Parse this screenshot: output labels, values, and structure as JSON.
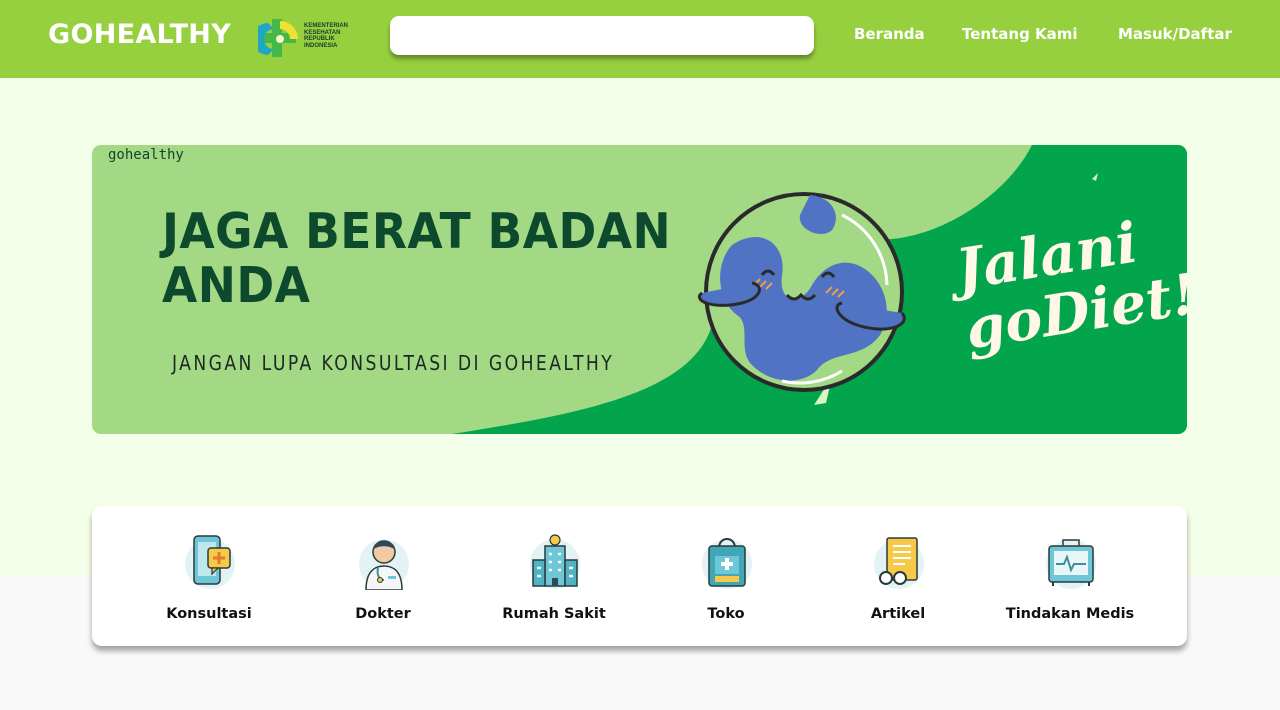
{
  "navbar": {
    "brand": "GOHEALTHY",
    "ministry_logo_text": "KEMENTERIAN KESEHATAN REPUBLIK INDONESIA",
    "search_value": "",
    "links": {
      "home": "Beranda",
      "about": "Tentang Kami",
      "login": "Masuk/Daftar"
    }
  },
  "banner": {
    "logo_text": "gohealthy",
    "headline": "JAGA BERAT BADAN ANDA",
    "subtitle": "JANGAN LUPA KONSULTASI DI GOHEALTHY",
    "script_text": "Jalani goDiet!",
    "colors": {
      "light": "#a3d884",
      "dark": "#02a54b",
      "text": "#0d4a2d"
    }
  },
  "services": [
    {
      "label": "Konsultasi",
      "icon": "phone-chat-icon"
    },
    {
      "label": "Dokter",
      "icon": "doctor-icon"
    },
    {
      "label": "Rumah Sakit",
      "icon": "hospital-icon"
    },
    {
      "label": "Toko",
      "icon": "shopping-bag-icon"
    },
    {
      "label": "Artikel",
      "icon": "article-icon"
    },
    {
      "label": "Tindakan Medis",
      "icon": "medical-monitor-icon"
    }
  ],
  "theme": {
    "navbar": "#97d03f",
    "hero_background": "#f4ffe9",
    "page_background": "#f9f9f9"
  }
}
